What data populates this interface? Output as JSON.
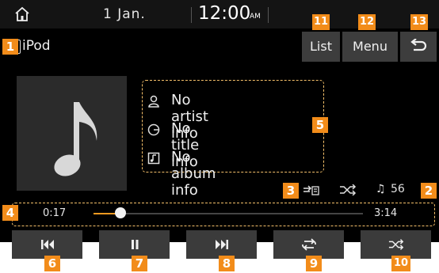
{
  "top_bar": {
    "date": "1  Jan.",
    "time": "12:00",
    "ampm": "AM",
    "icons": [
      "home-icon"
    ]
  },
  "source": {
    "label": "iPod",
    "icon": "music-note-icon"
  },
  "top_buttons": {
    "list": "List",
    "menu": "Menu",
    "back_icon": "back-icon"
  },
  "track_info": {
    "artist": "No artist info",
    "title": "No title info",
    "album": "No album info"
  },
  "status": {
    "song_count": "56",
    "repeat_icon": "repeat-folder-icon",
    "shuffle_icon": "shuffle-icon"
  },
  "progress": {
    "elapsed": "0:17",
    "total": "3:14",
    "fraction": 0.1
  },
  "controls": [
    {
      "name": "previous",
      "icon": "skip-previous-icon"
    },
    {
      "name": "pause",
      "icon": "pause-icon"
    },
    {
      "name": "next",
      "icon": "skip-next-icon"
    },
    {
      "name": "repeat",
      "icon": "repeat-icon"
    },
    {
      "name": "shuffle",
      "icon": "shuffle-icon"
    }
  ],
  "callouts": [
    "1",
    "2",
    "3",
    "4",
    "5",
    "6",
    "7",
    "8",
    "9",
    "10",
    "11",
    "12",
    "13"
  ],
  "colors": {
    "accent": "#f39a20",
    "callout": "#f28c1a",
    "button": "#3b3b3b",
    "background": "#000000"
  }
}
